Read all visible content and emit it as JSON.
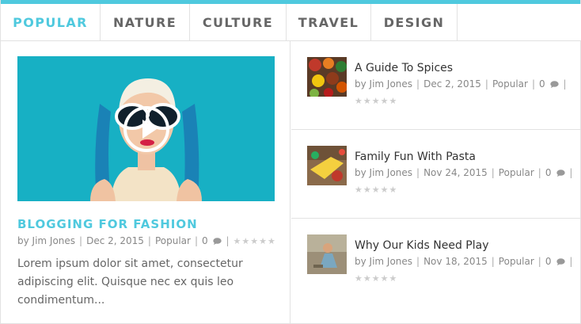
{
  "colors": {
    "accent": "#4fc9de",
    "border": "#e2e2e2"
  },
  "tabs": [
    {
      "label": "POPULAR",
      "active": true
    },
    {
      "label": "NATURE",
      "active": false
    },
    {
      "label": "CULTURE",
      "active": false
    },
    {
      "label": "TRAVEL",
      "active": false
    },
    {
      "label": "DESIGN",
      "active": false
    }
  ],
  "featured": {
    "title": "BLOGGING FOR FASHION",
    "by": "by Jim Jones",
    "date": "Dec 2, 2015",
    "category": "Popular",
    "comments": "0",
    "excerpt": "Lorem ipsum dolor sit amet, consectetur adipiscing elit. Quisque nec ex quis leo condimentum...",
    "icon": "play-icon"
  },
  "posts": [
    {
      "title": "A Guide To Spices",
      "by": "by Jim Jones",
      "date": "Dec 2, 2015",
      "category": "Popular",
      "comments": "0"
    },
    {
      "title": "Family Fun With Pasta",
      "by": "by Jim Jones",
      "date": "Nov 24, 2015",
      "category": "Popular",
      "comments": "0"
    },
    {
      "title": "Why Our Kids Need Play",
      "by": "by Jim Jones",
      "date": "Nov 18, 2015",
      "category": "Popular",
      "comments": "0"
    }
  ]
}
